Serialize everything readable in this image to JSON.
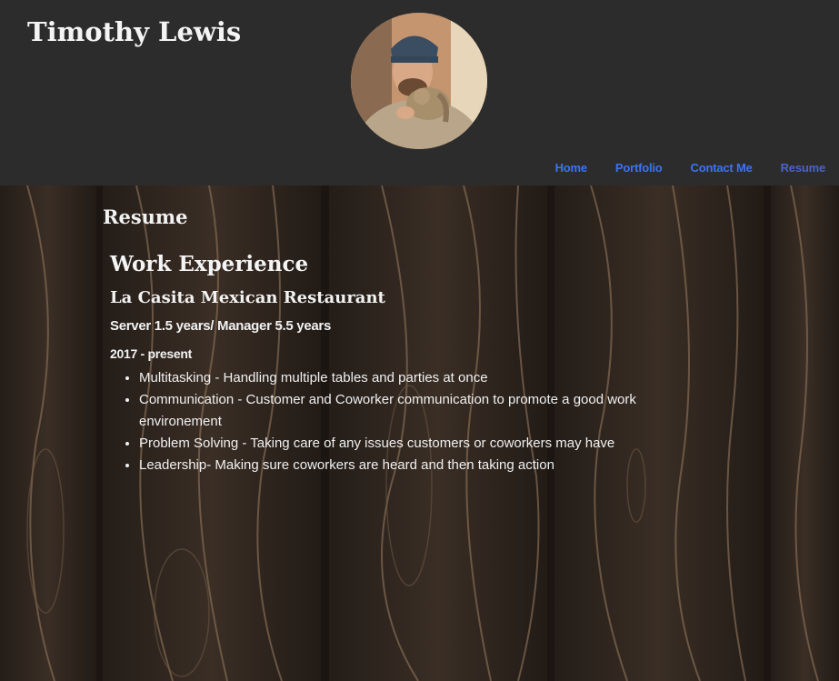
{
  "header": {
    "site_title": "Timothy Lewis"
  },
  "nav": {
    "items": [
      {
        "label": "Home"
      },
      {
        "label": "Portfolio"
      },
      {
        "label": "Contact Me"
      },
      {
        "label": "Resume"
      }
    ],
    "active": "Resume"
  },
  "main": {
    "page_heading": "Resume",
    "section_title": "Work Experience",
    "job": {
      "employer": "La Casita Mexican Restaurant",
      "role": "Server 1.5 years/ Manager 5.5 years",
      "dates": "2017 - present",
      "duties": [
        "Multitasking - Handling multiple tables and parties at once",
        "Communication - Customer and Coworker communication to promote a good work environement",
        "Problem Solving - Taking care of any issues customers or coworkers may have",
        "Leadership- Making sure coworkers are heard and then taking action"
      ]
    }
  },
  "colors": {
    "header_bg": "#2c2c2c",
    "nav_link": "#3b74f2",
    "text": "#f2f2f2",
    "wood_dark": "#1f1a16",
    "wood_grain": "#8a7058"
  },
  "icons": {
    "avatar": "profile-photo"
  }
}
